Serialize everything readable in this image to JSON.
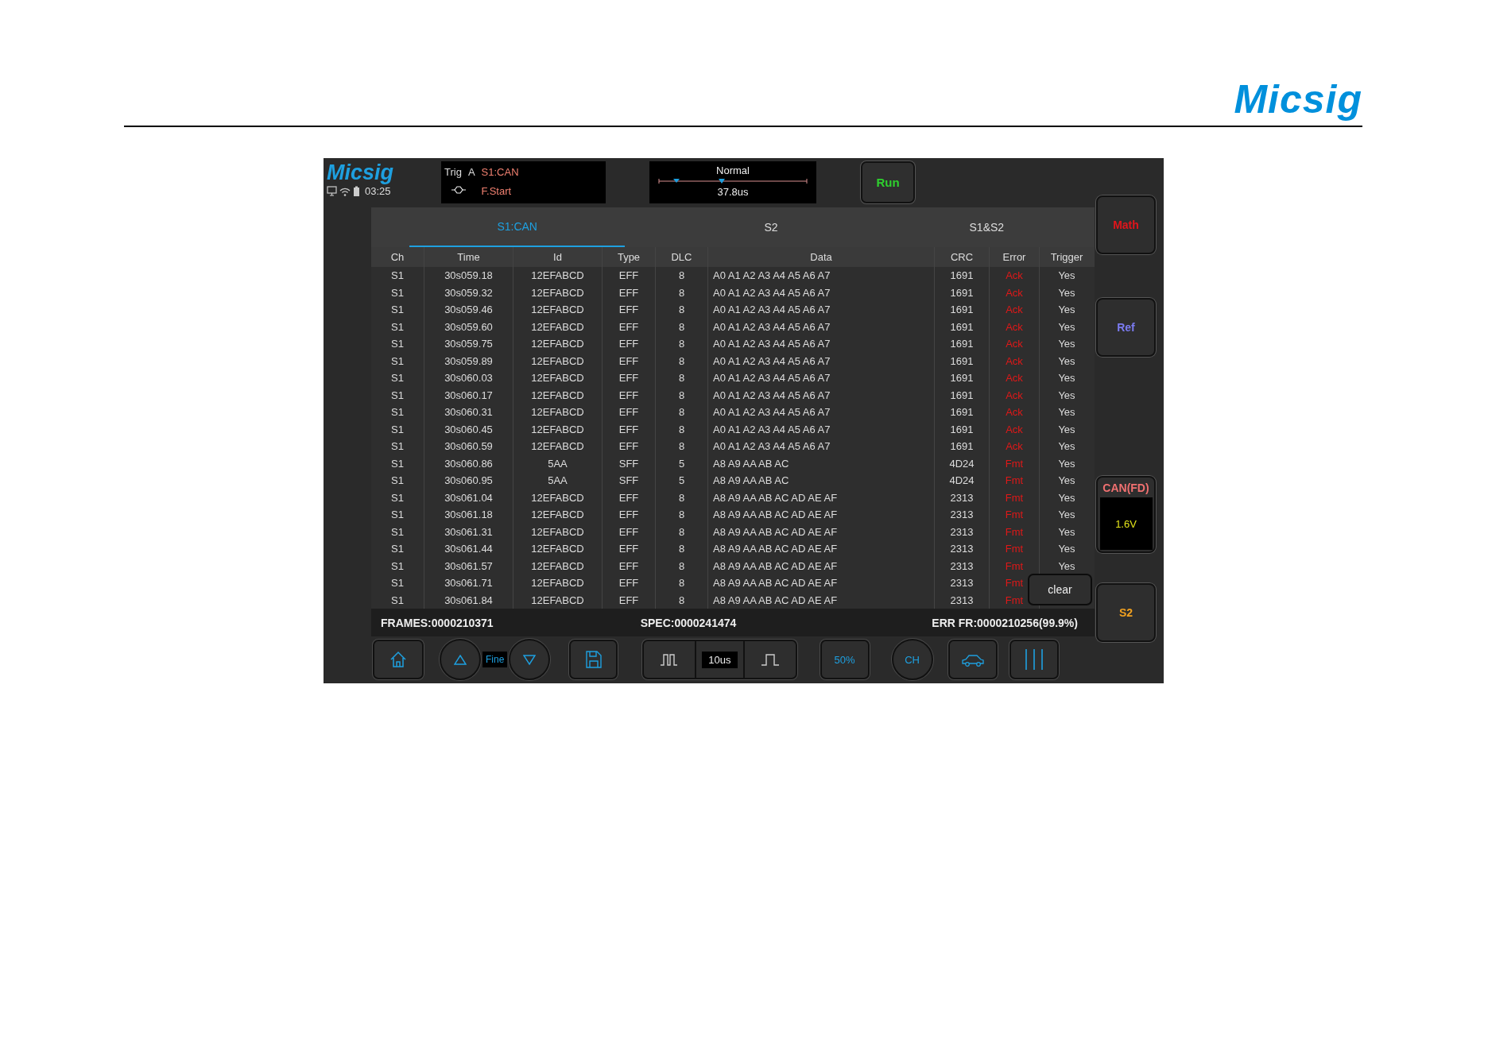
{
  "page_header": {
    "logo": "Micsig"
  },
  "screen": {
    "logo": "Micsig",
    "clock": "03:25",
    "trigger": {
      "label": "Trig",
      "channel": "A",
      "source": "S1:CAN",
      "mode": "F.Start"
    },
    "timebase": {
      "mode": "Normal",
      "position": "37.8us"
    },
    "run_button": "Run",
    "tabs": [
      {
        "label": "S1:CAN",
        "selected": true
      },
      {
        "label": "S2",
        "selected": false
      },
      {
        "label": "S1&S2",
        "selected": false
      }
    ],
    "table": {
      "columns": [
        "Ch",
        "Time",
        "Id",
        "Type",
        "DLC",
        "Data",
        "CRC",
        "Error",
        "Trigger"
      ],
      "rows": [
        {
          "ch": "S1",
          "time": "30s059.18",
          "id": "12EFABCD",
          "type": "EFF",
          "dlc": "8",
          "data": "A0 A1 A2 A3 A4 A5 A6 A7",
          "crc": "1691",
          "error": "Ack",
          "trigger": "Yes"
        },
        {
          "ch": "S1",
          "time": "30s059.32",
          "id": "12EFABCD",
          "type": "EFF",
          "dlc": "8",
          "data": "A0 A1 A2 A3 A4 A5 A6 A7",
          "crc": "1691",
          "error": "Ack",
          "trigger": "Yes"
        },
        {
          "ch": "S1",
          "time": "30s059.46",
          "id": "12EFABCD",
          "type": "EFF",
          "dlc": "8",
          "data": "A0 A1 A2 A3 A4 A5 A6 A7",
          "crc": "1691",
          "error": "Ack",
          "trigger": "Yes"
        },
        {
          "ch": "S1",
          "time": "30s059.60",
          "id": "12EFABCD",
          "type": "EFF",
          "dlc": "8",
          "data": "A0 A1 A2 A3 A4 A5 A6 A7",
          "crc": "1691",
          "error": "Ack",
          "trigger": "Yes"
        },
        {
          "ch": "S1",
          "time": "30s059.75",
          "id": "12EFABCD",
          "type": "EFF",
          "dlc": "8",
          "data": "A0 A1 A2 A3 A4 A5 A6 A7",
          "crc": "1691",
          "error": "Ack",
          "trigger": "Yes"
        },
        {
          "ch": "S1",
          "time": "30s059.89",
          "id": "12EFABCD",
          "type": "EFF",
          "dlc": "8",
          "data": "A0 A1 A2 A3 A4 A5 A6 A7",
          "crc": "1691",
          "error": "Ack",
          "trigger": "Yes"
        },
        {
          "ch": "S1",
          "time": "30s060.03",
          "id": "12EFABCD",
          "type": "EFF",
          "dlc": "8",
          "data": "A0 A1 A2 A3 A4 A5 A6 A7",
          "crc": "1691",
          "error": "Ack",
          "trigger": "Yes"
        },
        {
          "ch": "S1",
          "time": "30s060.17",
          "id": "12EFABCD",
          "type": "EFF",
          "dlc": "8",
          "data": "A0 A1 A2 A3 A4 A5 A6 A7",
          "crc": "1691",
          "error": "Ack",
          "trigger": "Yes"
        },
        {
          "ch": "S1",
          "time": "30s060.31",
          "id": "12EFABCD",
          "type": "EFF",
          "dlc": "8",
          "data": "A0 A1 A2 A3 A4 A5 A6 A7",
          "crc": "1691",
          "error": "Ack",
          "trigger": "Yes"
        },
        {
          "ch": "S1",
          "time": "30s060.45",
          "id": "12EFABCD",
          "type": "EFF",
          "dlc": "8",
          "data": "A0 A1 A2 A3 A4 A5 A6 A7",
          "crc": "1691",
          "error": "Ack",
          "trigger": "Yes"
        },
        {
          "ch": "S1",
          "time": "30s060.59",
          "id": "12EFABCD",
          "type": "EFF",
          "dlc": "8",
          "data": "A0 A1 A2 A3 A4 A5 A6 A7",
          "crc": "1691",
          "error": "Ack",
          "trigger": "Yes"
        },
        {
          "ch": "S1",
          "time": "30s060.86",
          "id": "5AA",
          "type": "SFF",
          "dlc": "5",
          "data": "A8 A9 AA AB AC",
          "crc": "4D24",
          "error": "Fmt",
          "trigger": "Yes"
        },
        {
          "ch": "S1",
          "time": "30s060.95",
          "id": "5AA",
          "type": "SFF",
          "dlc": "5",
          "data": "A8 A9 AA AB AC",
          "crc": "4D24",
          "error": "Fmt",
          "trigger": "Yes"
        },
        {
          "ch": "S1",
          "time": "30s061.04",
          "id": "12EFABCD",
          "type": "EFF",
          "dlc": "8",
          "data": "A8 A9 AA AB AC AD AE AF",
          "crc": "2313",
          "error": "Fmt",
          "trigger": "Yes"
        },
        {
          "ch": "S1",
          "time": "30s061.18",
          "id": "12EFABCD",
          "type": "EFF",
          "dlc": "8",
          "data": "A8 A9 AA AB AC AD AE AF",
          "crc": "2313",
          "error": "Fmt",
          "trigger": "Yes"
        },
        {
          "ch": "S1",
          "time": "30s061.31",
          "id": "12EFABCD",
          "type": "EFF",
          "dlc": "8",
          "data": "A8 A9 AA AB AC AD AE AF",
          "crc": "2313",
          "error": "Fmt",
          "trigger": "Yes"
        },
        {
          "ch": "S1",
          "time": "30s061.44",
          "id": "12EFABCD",
          "type": "EFF",
          "dlc": "8",
          "data": "A8 A9 AA AB AC AD AE AF",
          "crc": "2313",
          "error": "Fmt",
          "trigger": "Yes"
        },
        {
          "ch": "S1",
          "time": "30s061.57",
          "id": "12EFABCD",
          "type": "EFF",
          "dlc": "8",
          "data": "A8 A9 AA AB AC AD AE AF",
          "crc": "2313",
          "error": "Fmt",
          "trigger": "Yes"
        },
        {
          "ch": "S1",
          "time": "30s061.71",
          "id": "12EFABCD",
          "type": "EFF",
          "dlc": "8",
          "data": "A8 A9 AA AB AC AD AE AF",
          "crc": "2313",
          "error": "Fmt"
        },
        {
          "ch": "S1",
          "time": "30s061.84",
          "id": "12EFABCD",
          "type": "EFF",
          "dlc": "8",
          "data": "A8 A9 AA AB AC AD AE AF",
          "crc": "2313",
          "error": "Fmt"
        }
      ]
    },
    "clear_button": "clear",
    "status": {
      "frames": "FRAMES:0000210371",
      "spec": "SPEC:0000241474",
      "err": "ERR FR:0000210256(99.9%)"
    },
    "side_buttons": [
      {
        "kind": "button",
        "label": "Math",
        "color": "#e0151b"
      },
      {
        "kind": "button",
        "label": "Ref",
        "color": "#7b7bf0"
      },
      {
        "kind": "channel",
        "label": "CAN(FD)",
        "value": "1.6V",
        "color": "#f07070"
      },
      {
        "kind": "button",
        "label": "S2",
        "color": "#f0a020"
      }
    ],
    "toolbar": {
      "step": "Fine",
      "timebase": "10us",
      "level": "50%",
      "channel": "CH"
    }
  }
}
